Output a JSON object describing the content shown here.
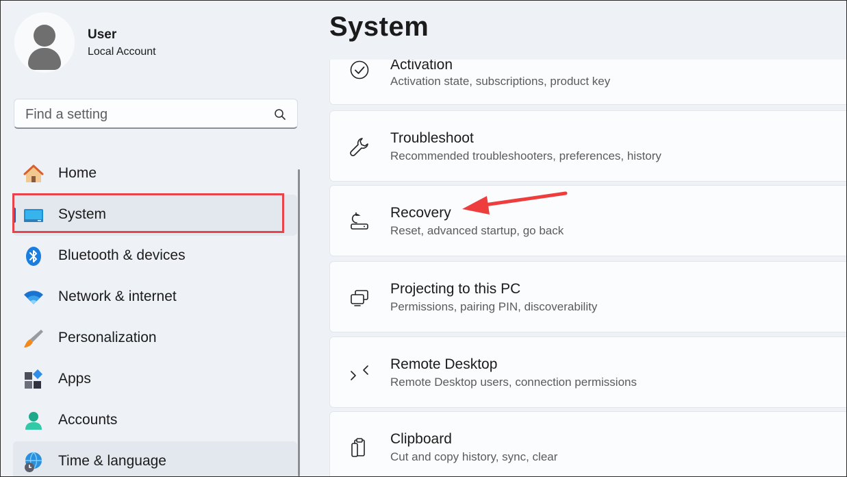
{
  "user": {
    "name": "User",
    "account_type": "Local Account"
  },
  "search": {
    "placeholder": "Find a setting"
  },
  "nav": {
    "items": [
      {
        "label": "Home",
        "icon": "home-icon"
      },
      {
        "label": "System",
        "icon": "system-icon",
        "selected": true
      },
      {
        "label": "Bluetooth & devices",
        "icon": "bluetooth-icon"
      },
      {
        "label": "Network & internet",
        "icon": "wifi-icon"
      },
      {
        "label": "Personalization",
        "icon": "brush-icon"
      },
      {
        "label": "Apps",
        "icon": "apps-icon"
      },
      {
        "label": "Accounts",
        "icon": "accounts-icon"
      },
      {
        "label": "Time & language",
        "icon": "globe-clock-icon"
      }
    ]
  },
  "main": {
    "title": "System",
    "cards": [
      {
        "title": "Activation",
        "subtitle": "Activation state, subscriptions, product key",
        "icon": "check-circle-icon"
      },
      {
        "title": "Troubleshoot",
        "subtitle": "Recommended troubleshooters, preferences, history",
        "icon": "wrench-icon"
      },
      {
        "title": "Recovery",
        "subtitle": "Reset, advanced startup, go back",
        "icon": "recovery-icon"
      },
      {
        "title": "Projecting to this PC",
        "subtitle": "Permissions, pairing PIN, discoverability",
        "icon": "projecting-icon"
      },
      {
        "title": "Remote Desktop",
        "subtitle": "Remote Desktop users, connection permissions",
        "icon": "remote-desktop-icon"
      },
      {
        "title": "Clipboard",
        "subtitle": "Cut and copy history, sync, clear",
        "icon": "clipboard-icon"
      }
    ]
  },
  "annotations": {
    "highlight_color": "#e8434b",
    "arrow_color": "#ee3d3d"
  },
  "colors": {
    "accent": "#1f5fbf",
    "background": "#eef2f7",
    "card": "#fbfcfd"
  }
}
